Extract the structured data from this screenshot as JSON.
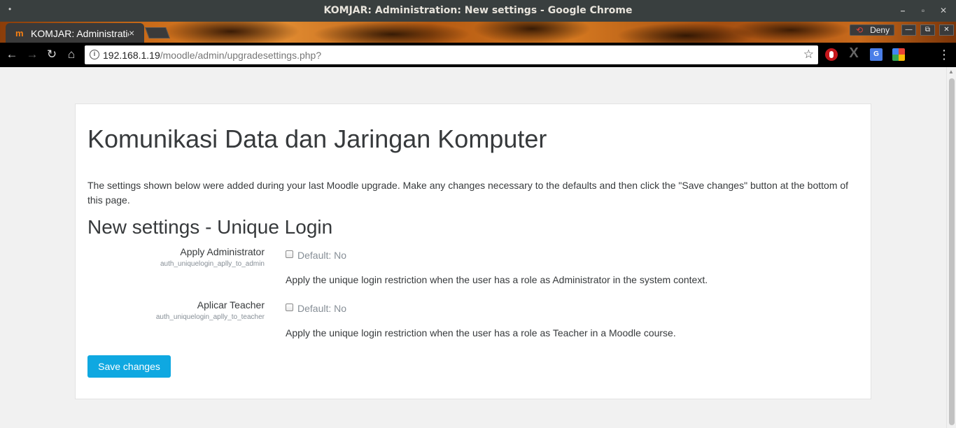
{
  "window": {
    "title": "KOMJAR: Administration: New settings - Google Chrome",
    "dot": "•",
    "minimize": "–",
    "maximize": "▫",
    "close": "✕"
  },
  "tab": {
    "favicon": "m",
    "label": "KOMJAR: Administration: New settings",
    "close": "×"
  },
  "deny": {
    "icon": "⟲",
    "label": "Deny"
  },
  "toolbar": {
    "back": "←",
    "forward": "→",
    "reload": "↻",
    "home": "⌂",
    "url_host": "192.168.1.19",
    "url_path": "/moodle/admin/upgradesettings.php?",
    "star": "☆",
    "menu": "⋮",
    "ext_x": "X",
    "ext_gt": "G"
  },
  "page": {
    "site_title": "Komunikasi Data dan Jaringan Komputer",
    "intro": "The settings shown below were added during your last Moodle upgrade. Make any changes necessary to the defaults and then click the \"Save changes\" button at the bottom of this page.",
    "section_title": "New settings - Unique Login",
    "settings": [
      {
        "label": "Apply Administrator",
        "key": "auth_uniquelogin_aplly_to_admin",
        "default": "Default: No",
        "checked": false,
        "description": "Apply the unique login restriction when the user has a role as Administrator in the system context."
      },
      {
        "label": "Aplicar Teacher",
        "key": "auth_uniquelogin_aplly_to_teacher",
        "default": "Default: No",
        "checked": false,
        "description": "Apply the unique login restriction when the user has a role as Teacher in a Moodle course."
      }
    ],
    "save_label": "Save changes"
  },
  "colors": {
    "primary_button": "#0fa8e1",
    "text": "#373a3c",
    "muted": "#868e96"
  }
}
